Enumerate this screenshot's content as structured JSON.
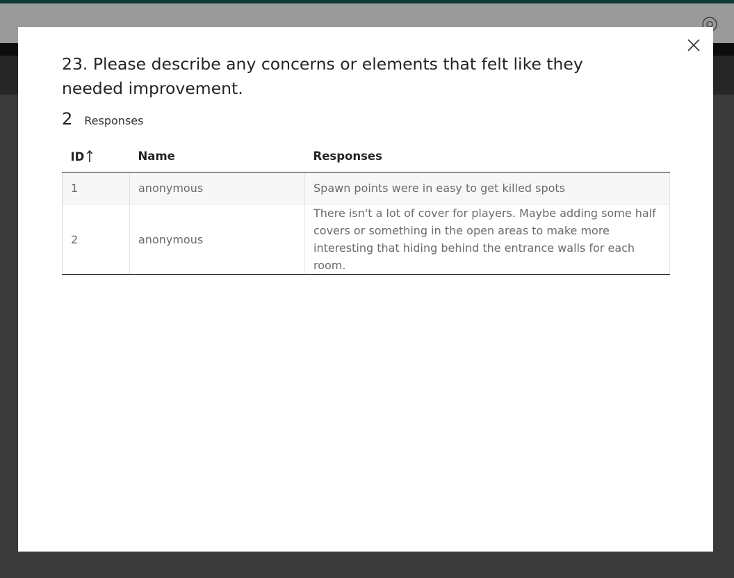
{
  "colors": {
    "backdrop": "#3a3a3a",
    "modal_bg": "#ffffff",
    "title_text": "#252423",
    "cell_text": "#6a6a6a",
    "row_alt_bg": "#f7f7f7",
    "top_accent": "#0f3a34"
  },
  "icons": {
    "close": "close-icon",
    "sort": "sort-ascending-icon",
    "help": "help-icon"
  },
  "modal": {
    "question_title": "23. Please describe any concerns or elements that felt like they needed improvement.",
    "response_count": "2",
    "response_label": "Responses",
    "table": {
      "headers": {
        "id": "ID",
        "name": "Name",
        "responses": "Responses"
      },
      "sort": "ID ascending",
      "rows": [
        {
          "id": "1",
          "name": "anonymous",
          "response": "Spawn points were in easy to get killed spots"
        },
        {
          "id": "2",
          "name": "anonymous",
          "response": "There isn't a lot of cover for players. Maybe adding some half covers or something in the open areas to make more interesting that hiding behind the entrance walls for each room."
        }
      ]
    }
  }
}
